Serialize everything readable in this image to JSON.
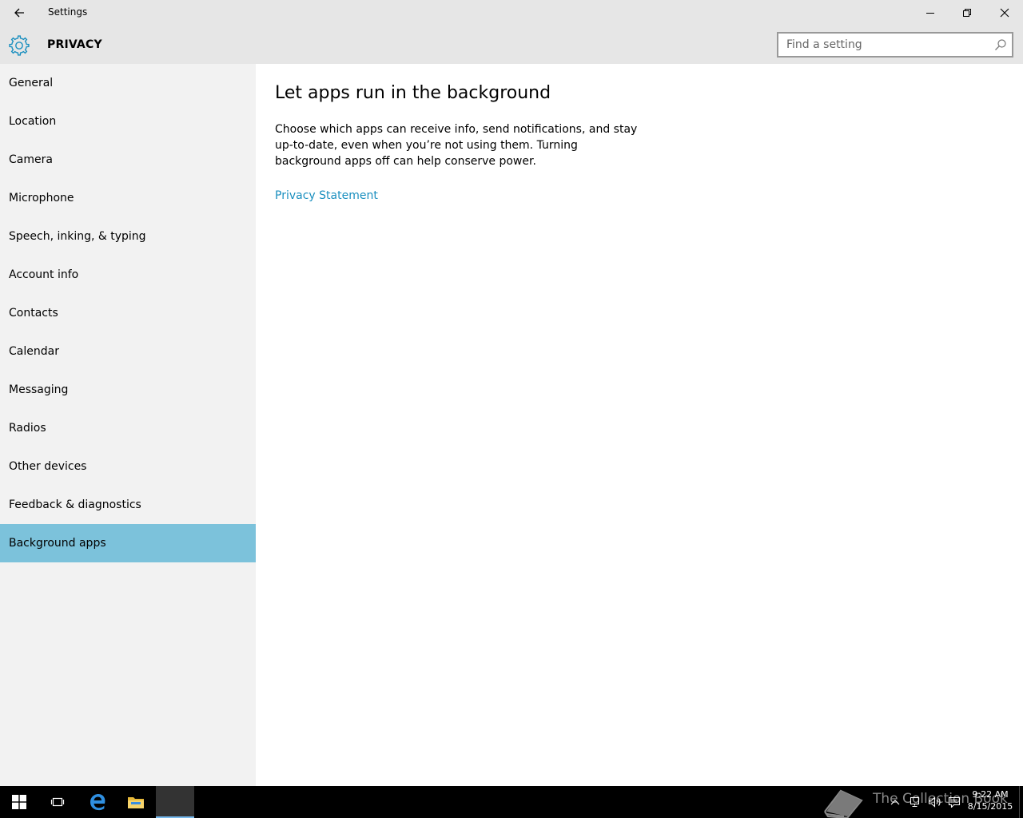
{
  "window": {
    "title": "Settings",
    "icons": {
      "back": "back-arrow-icon",
      "minimize": "minimize-icon",
      "maximize": "restore-icon",
      "close": "close-icon"
    }
  },
  "header": {
    "section_title": "PRIVACY",
    "icon": "gear-icon",
    "search_placeholder": "Find a setting",
    "search_value": ""
  },
  "sidebar": {
    "items": [
      {
        "label": "General"
      },
      {
        "label": "Location"
      },
      {
        "label": "Camera"
      },
      {
        "label": "Microphone"
      },
      {
        "label": "Speech, inking, & typing"
      },
      {
        "label": "Account info"
      },
      {
        "label": "Contacts"
      },
      {
        "label": "Calendar"
      },
      {
        "label": "Messaging"
      },
      {
        "label": "Radios"
      },
      {
        "label": "Other devices"
      },
      {
        "label": "Feedback & diagnostics"
      },
      {
        "label": "Background apps",
        "selected": true
      }
    ]
  },
  "main": {
    "title": "Let apps run in the background",
    "description": "Choose which apps can receive info, send notifications, and stay up-to-date, even when you’re not using them. Turning background apps off can help conserve power.",
    "link": "Privacy Statement"
  },
  "taskbar": {
    "watermark": "The Collection Book",
    "time": "9:22 AM",
    "date": "8/15/2015"
  },
  "colors": {
    "accent": "#7cc2db",
    "link": "#1a8fbf",
    "chrome": "#e6e6e6",
    "sidebar": "#f2f2f2",
    "taskbar": "#000000",
    "gear": "#1a8fbf"
  }
}
